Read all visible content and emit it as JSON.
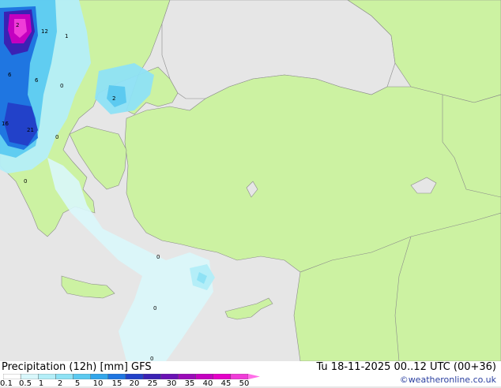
{
  "title": "Precipitation (12h) [mm] GFS",
  "valid_time": "Tu 18-11-2025 00..12 UTC (00+36)",
  "credit": "©weatheronline.co.uk",
  "legend": {
    "ticks": [
      "0.1",
      "0.5",
      "1",
      "2",
      "5",
      "10",
      "15",
      "20",
      "25",
      "30",
      "35",
      "40",
      "45",
      "50"
    ],
    "colors": [
      "#ffffff",
      "#d9f7fb",
      "#b4eef8",
      "#8ee2f5",
      "#5ccaf0",
      "#33a6ea",
      "#1f76e1",
      "#2241c9",
      "#3a22b4",
      "#6a12b4",
      "#9a0ab8",
      "#c400c0",
      "#e400c8",
      "#f03cd8",
      "#ff6fe8"
    ]
  },
  "map_values": [
    "2",
    "12",
    "1",
    "6",
    "6",
    "0",
    "2",
    "16",
    "21",
    "0",
    "0",
    "0",
    "0",
    "0"
  ],
  "colors": {
    "land": "#ccf2a2",
    "sea": "#e6e6e6",
    "border": "#8a8a8a"
  }
}
